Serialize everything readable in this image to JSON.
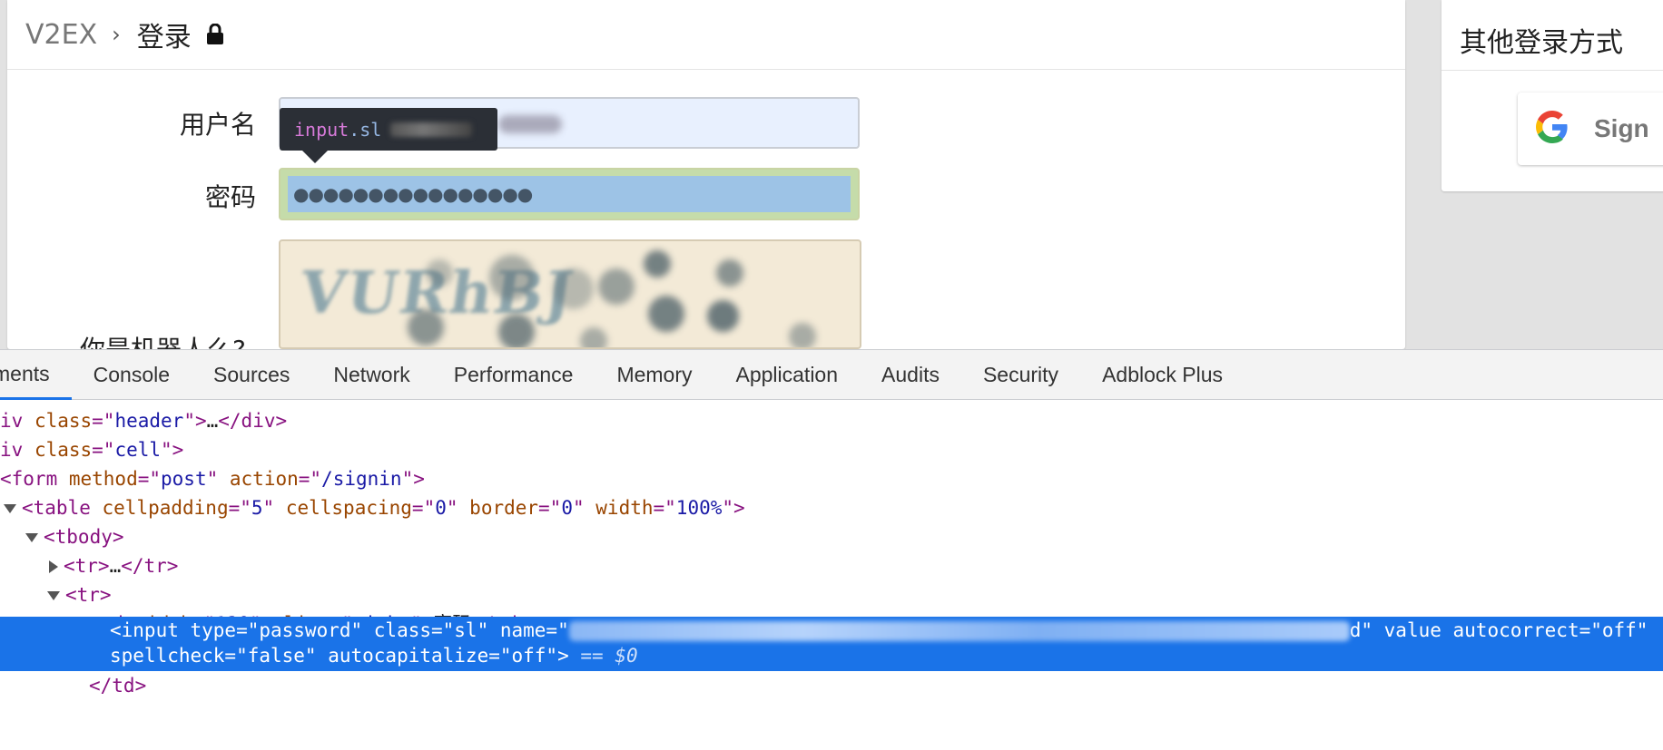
{
  "breadcrumb": {
    "home": "V2EX",
    "separator": "›",
    "title": "登录"
  },
  "form": {
    "username_label": "用户名",
    "password_label": "密码",
    "password_value": "●●●●●●●●●●●●●●●●",
    "robot_label": "你是机器人么?",
    "captcha_text": "VURhBJ"
  },
  "tooltip": {
    "tag": "input",
    "class": ".sl"
  },
  "sidebar": {
    "title": "其他登录方式",
    "google_label": "Sign"
  },
  "devtools": {
    "tabs": [
      "ments",
      "Console",
      "Sources",
      "Network",
      "Performance",
      "Memory",
      "Application",
      "Audits",
      "Security",
      "Adblock Plus"
    ],
    "active_tab": "ments",
    "accent_color": "#1a73e8",
    "selected_line1_prefix": "<input type=\"password\" class=\"sl\" name=\"",
    "selected_line1_suffix": "d\" value autocorrect=\"off\"",
    "selected_line2": "spellcheck=\"false\" autocapitalize=\"off\">",
    "selected_marker": "== $0",
    "closing_td": "</td>"
  }
}
